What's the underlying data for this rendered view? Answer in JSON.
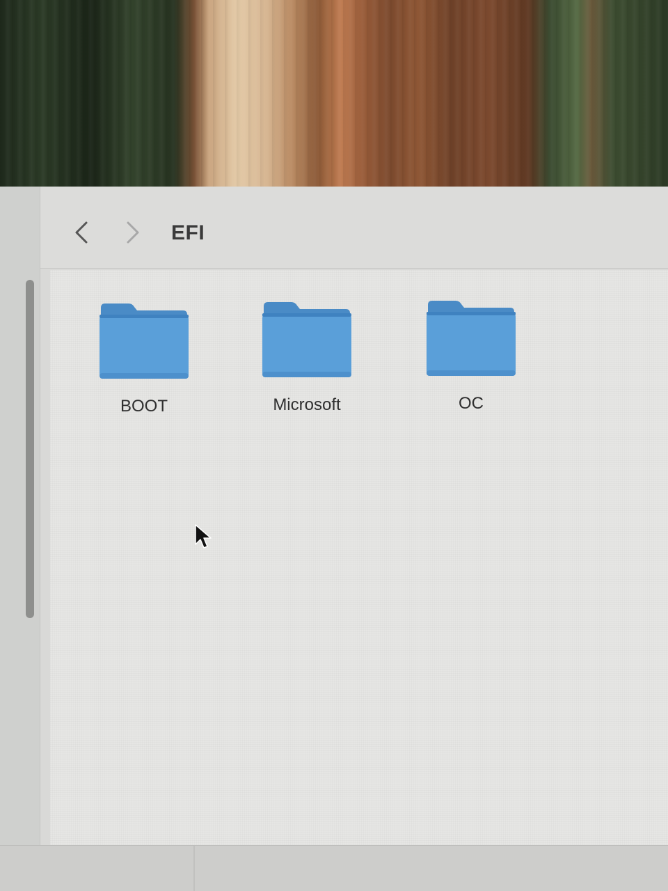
{
  "window": {
    "title": "EFI",
    "nav": {
      "back_icon": "chevron-left-icon",
      "forward_icon": "chevron-right-icon"
    }
  },
  "folders": [
    {
      "name": "BOOT",
      "icon": "folder-icon"
    },
    {
      "name": "Microsoft",
      "icon": "folder-icon"
    },
    {
      "name": "OC",
      "icon": "folder-icon"
    }
  ],
  "colors": {
    "folder_body": "#5a9fd9",
    "folder_tab": "#4a8bc6",
    "window_bg": "#e6e6e4"
  }
}
